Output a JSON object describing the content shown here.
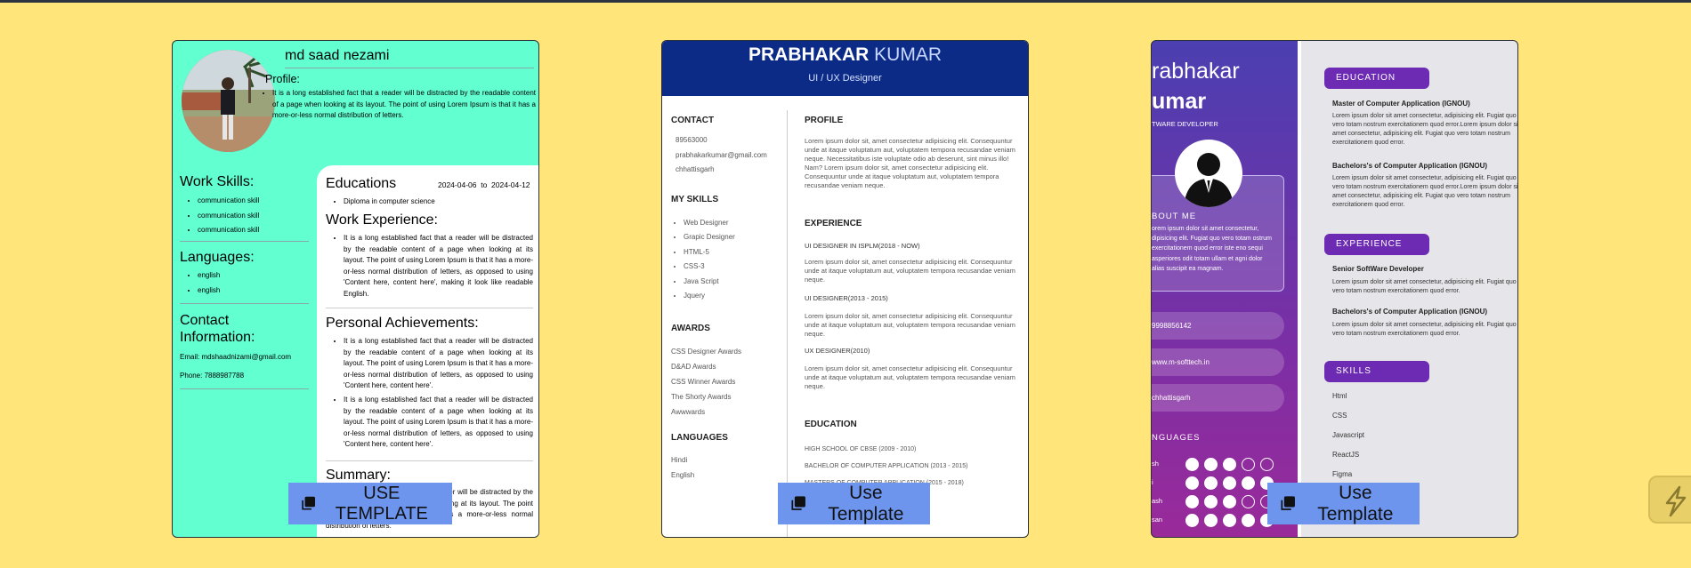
{
  "buttons": {
    "card1": "USE TEMPLATE",
    "card2": "Use Template",
    "card3": "Use Template"
  },
  "card1": {
    "name": "md saad nezami",
    "profile_heading": "Profile:",
    "profile_text": "It is a long established fact that a reader will be distracted by the readable content of a page when looking at its layout. The point of using Lorem Ipsum is that it has a more-or-less normal distribution of letters.",
    "work_skills_heading": "Work Skills:",
    "work_skills": [
      "communication skill",
      "communication skill",
      "communication skill"
    ],
    "languages_heading": "Languages:",
    "languages": [
      "english",
      "english"
    ],
    "contact_heading": "Contact Information:",
    "email": "Email: mdshaadnizami@gmail.com",
    "phone": "Phone: 7888987788",
    "educations_heading": "Educations",
    "edu_start": "2024-04-06",
    "edu_to": "to",
    "edu_end": "2024-04-12",
    "edu_item": "Diploma in computer science",
    "work_heading": "Work Experience:",
    "work_text": "It is a long established fact that a reader will be distracted by the readable content of a page when looking at its layout. The point of using Lorem Ipsum is that it has a more-or-less normal distribution of letters, as opposed to using 'Content here, content here', making it look like readable English.",
    "achievements_heading": "Personal Achievements:",
    "achievement1": "It is a long established fact that a reader will be distracted by the readable content of a page when looking at its layout. The point of using Lorem Ipsum is that it has a more-or-less normal distribution of letters, as opposed to using 'Content here, content here'.",
    "achievement2": "It is a long established fact that a reader will be distracted by the readable content of a page when looking at its layout. The point of using Lorem Ipsum is that it has a more-or-less normal distribution of letters, as opposed to using 'Content here, content here'.",
    "summary_heading": "Summary:",
    "summary_text": "It is a long established fact that a reader will be distracted by the readable content of a page when looking at its layout. The point of using Lorem Ipsum is that it has a more-or-less normal distribution of letters."
  },
  "card2": {
    "first_name": "PRABHAKAR",
    "last_name": "KUMAR",
    "role": "UI / UX Designer",
    "contact_heading": "CONTACT",
    "contacts": [
      "89563000",
      "prabhakarkumar@gmail.com",
      "chhattisgarh"
    ],
    "skills_heading": "MY SKILLS",
    "skills": [
      "Web Designer",
      "Grapic Designer",
      "HTML-5",
      "CSS-3",
      "Java Script",
      "Jquery"
    ],
    "awards_heading": "AWARDS",
    "awards": [
      "CSS Designer Awards",
      "D&AD Awards",
      "CSS Winner Awards",
      "The Shorty Awards",
      "Awwwards"
    ],
    "languages_heading": "LANGUAGES",
    "languages": [
      "Hindi",
      "English"
    ],
    "profile_heading": "PROFILE",
    "profile_text": "Lorem ipsum dolor sit, amet consectetur adipisicing elit. Consequuntur unde at itaque voluptatum aut, voluptatem tempora recusandae veniam neque. Necessitatibus iste voluptate odio ab deserunt, sint minus illo! Nam? Lorem ipsum dolor sit, amet consectetur adipisicing elit. Consequuntur unde at itaque voluptatum aut, voluptatem tempora recusandae veniam neque.",
    "experience_heading": "EXPERIENCE",
    "jobs": [
      {
        "title": "UI DESIGNER IN ISPLM(2018 - NOW)",
        "text": "Lorem ipsum dolor sit, amet consectetur adipisicing elit. Consequuntur unde at itaque voluptatum aut, voluptatem tempora recusandae veniam neque."
      },
      {
        "title": "UI DESIGNER(2013 - 2015)",
        "text": "Lorem ipsum dolor sit, amet consectetur adipisicing elit. Consequuntur unde at itaque voluptatum aut, voluptatem tempora recusandae veniam neque."
      },
      {
        "title": "UX DESIGNER(2010)",
        "text": "Lorem ipsum dolor sit, amet consectetur adipisicing elit. Consequuntur unde at itaque voluptatum aut, voluptatem tempora recusandae veniam neque."
      }
    ],
    "education_heading": "EDUCATION",
    "education": [
      "HIGH SCHOOL OF CBSE (2009 - 2010)",
      "BACHELOR OF COMPUTER APPLICATION (2013 - 2015)",
      "MASTERS OF COMPUTER APPLICATION (2015 - 2018)"
    ]
  },
  "card3": {
    "name_line1": "rabhakar",
    "name_line2": "umar",
    "title": "TWARE DEVELOPER",
    "about_heading": "BOUT ME",
    "about_text": "orem ipsum dolor sit amet consectetur, dipisicing elit. Fugiat quo vero totam ostrum exercitationem quod error iste eno sequi asperiores odit totam ullam et agni dolor alias suscipit ea magnam.",
    "phone": "9998856142",
    "website": "www.m-softtech.in",
    "location": "chhattisgarh",
    "languages_heading": "NGUAGES",
    "languages": [
      {
        "label": "sh",
        "level": 4
      },
      {
        "label": "i",
        "level": 5
      },
      {
        "label": "ash",
        "level": 3
      },
      {
        "label": "san",
        "level": 5
      }
    ],
    "education_heading": "EDUCATION",
    "education": [
      {
        "title": "Master of Computer Application (IGNOU)",
        "text": "Lorem ipsum dolor sit amet consectetur, adipisicing elit. Fugiat quo vero totam nostrum exercitationem quod error.Lorem ipsum dolor sit amet consectetur, adipisicing elit. Fugiat quo vero totam nostrum exercitationem quod error."
      },
      {
        "title": "Bachelors's of Computer Application (IGNOU)",
        "text": "Lorem ipsum dolor sit amet consectetur, adipisicing elit. Fugiat quo vero totam nostrum exercitationem quod error.Lorem ipsum dolor sit amet consectetur, adipisicing elit. Fugiat quo vero totam nostrum exercitationem quod error."
      }
    ],
    "experience_heading": "EXPERIENCE",
    "experience": [
      {
        "title": "Senior SoftWare Developer",
        "text": "Lorem ipsum dolor sit amet consectetur, adipisicing elit. Fugiat quo vero totam nostrum exercitationem quod error."
      },
      {
        "title": "Bachelors's of Computer Application (IGNOU)",
        "text": "Lorem ipsum dolor sit amet consectetur, adipisicing elit. Fugiat quo vero totam nostrum exercitationem quod error."
      }
    ],
    "skills_heading": "SKILLS",
    "skills": [
      "Html",
      "CSS",
      "Javascript",
      "ReactJS",
      "Figma"
    ]
  }
}
